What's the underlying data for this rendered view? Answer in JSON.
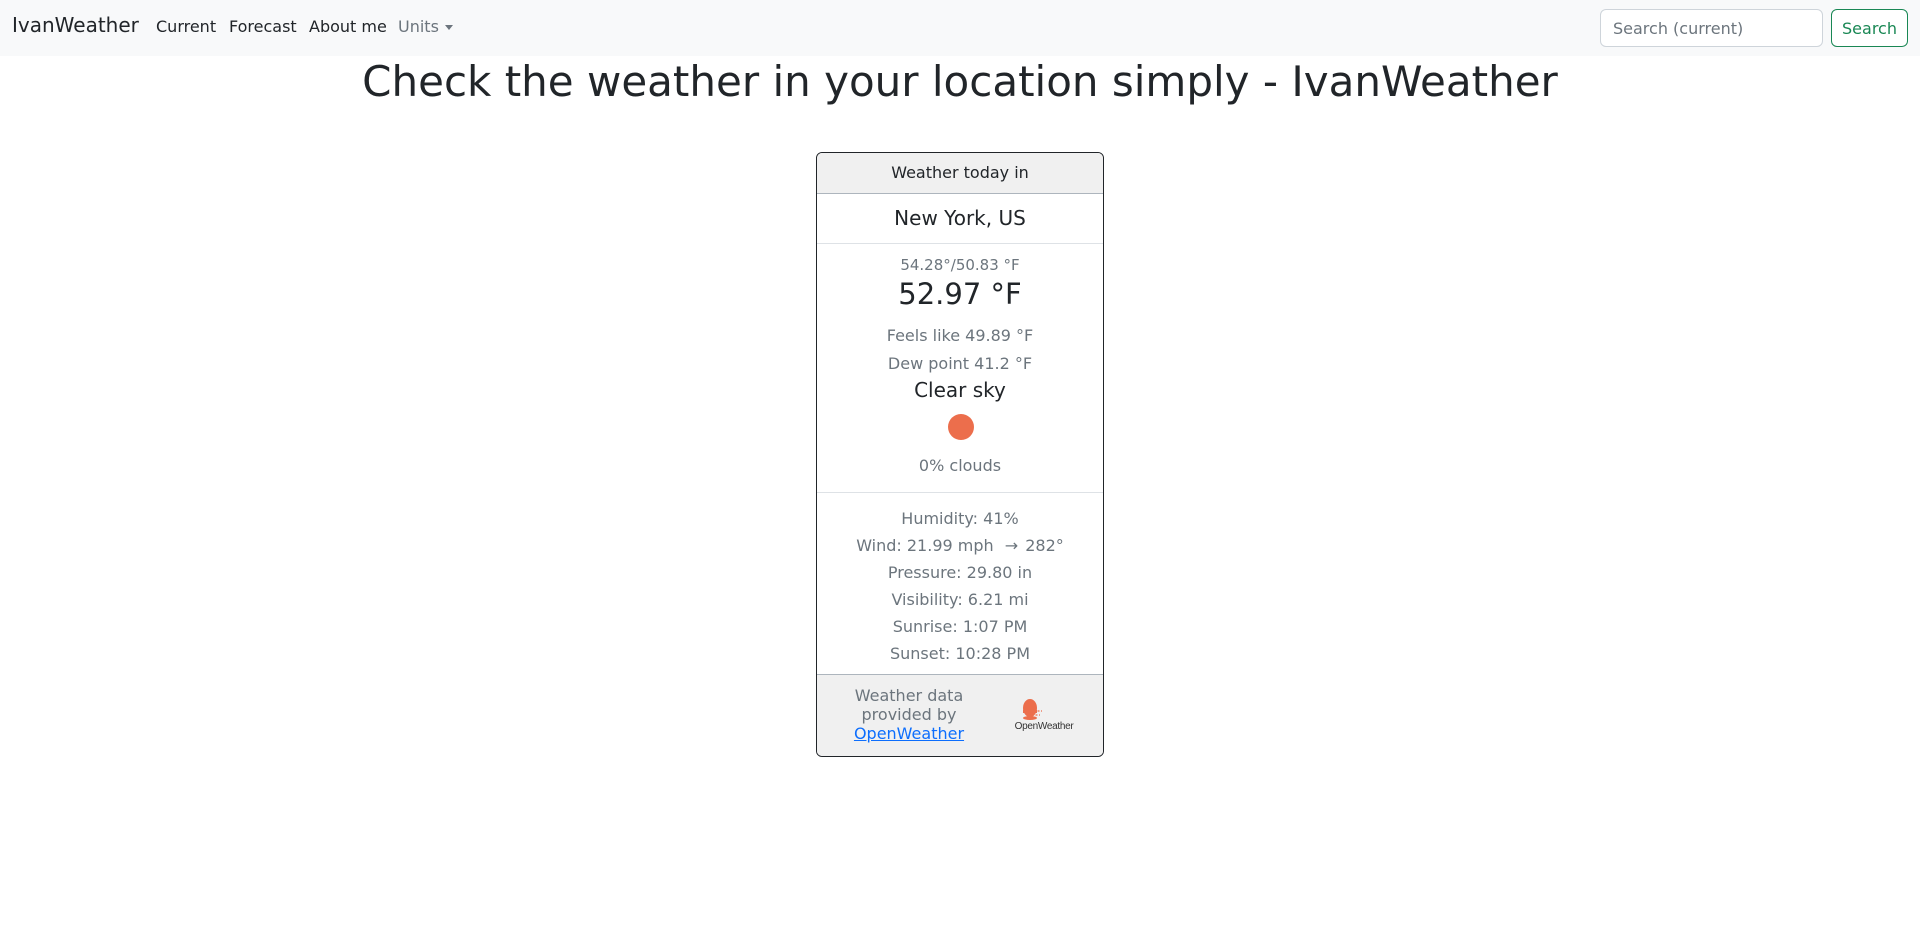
{
  "navbar": {
    "brand": "IvanWeather",
    "links": [
      "Current",
      "Forecast",
      "About me"
    ],
    "units_label": "Units",
    "search_placeholder": "Search (current)",
    "search_button": "Search"
  },
  "page_title": "Check the weather in your location simply - IvanWeather",
  "card": {
    "header": "Weather today in",
    "location": "New York, US",
    "min_max": "54.28°/50.83 °F",
    "temperature": "52.97 °F",
    "feels_like": "Feels like 49.89 °F",
    "dew_point": "Dew point 41.2 °F",
    "condition": "Clear sky",
    "icon": "sun-icon",
    "clouds": "0% clouds",
    "humidity": "Humidity: 41%",
    "wind": "Wind: 21.99 mph",
    "wind_arrow": "→",
    "wind_direction": "282°",
    "pressure": "Pressure: 29.80 in",
    "visibility": "Visibility: 6.21 mi",
    "sunrise": "Sunrise: 1:07 PM",
    "sunset": "Sunset: 10:28 PM",
    "footer_text": "Weather data provided by",
    "footer_link": "OpenWeather",
    "logo_label": "OpenWeather"
  },
  "colors": {
    "accent": "#198754",
    "sun": "#ec6e4c",
    "link": "#0d6efd"
  }
}
